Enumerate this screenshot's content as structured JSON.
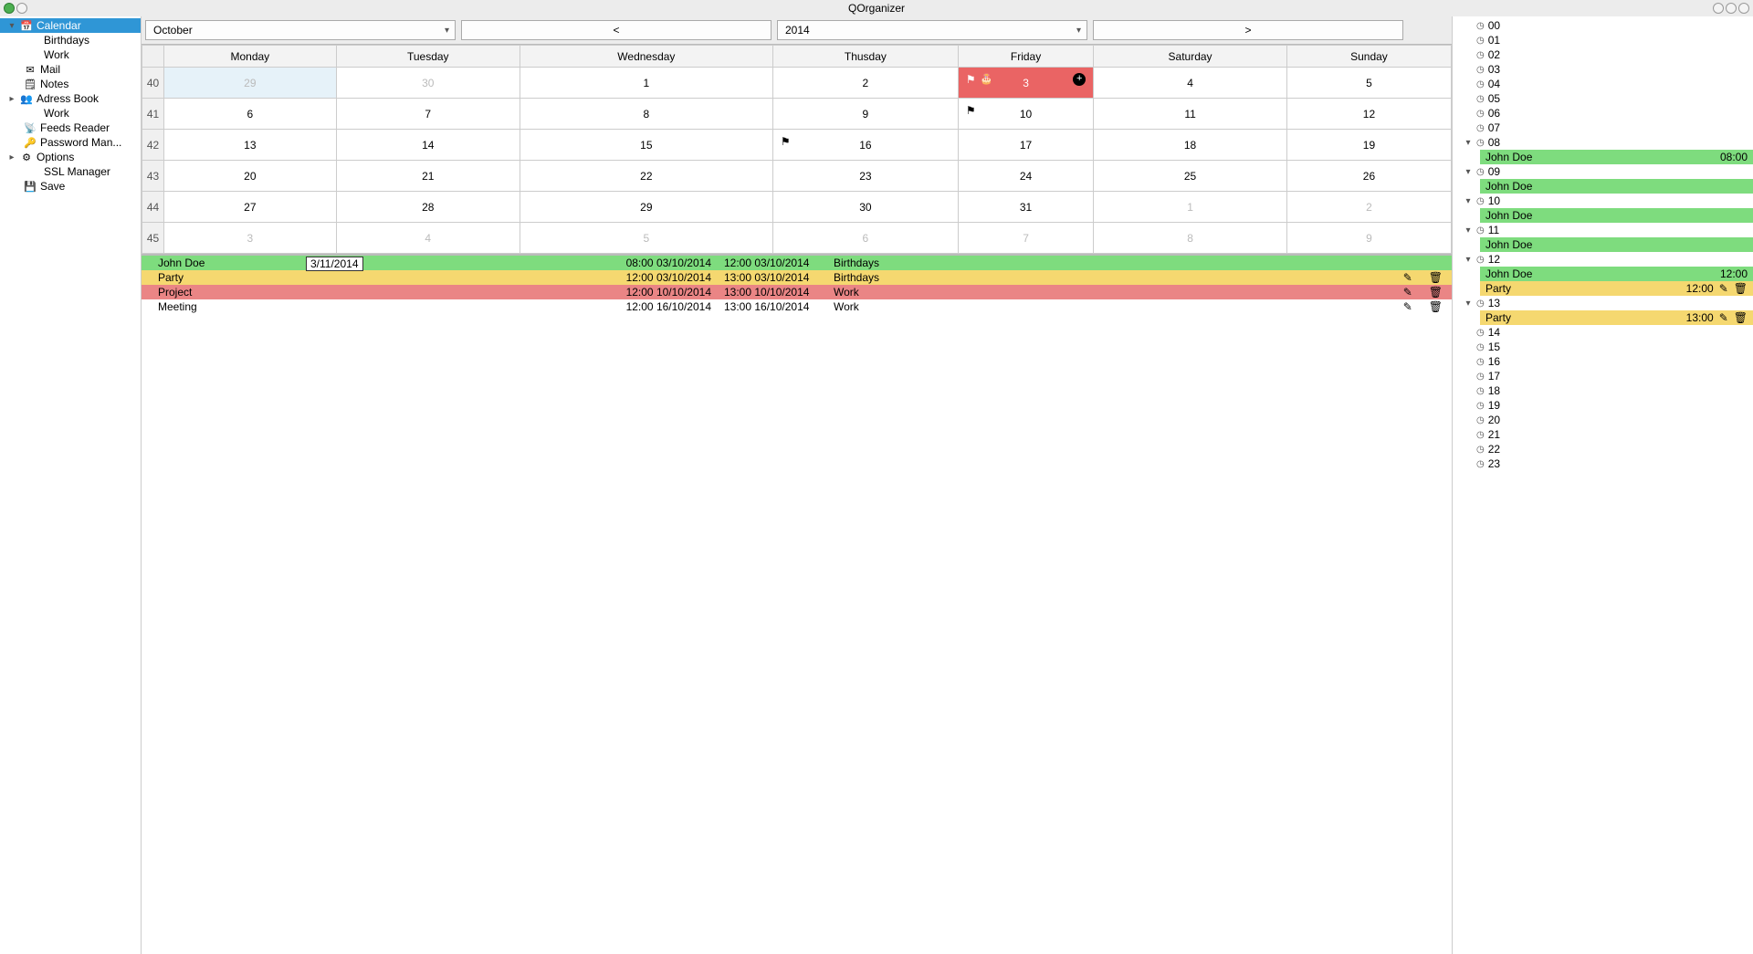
{
  "window": {
    "title": "QOrganizer"
  },
  "sidebar": {
    "items": [
      {
        "label": "Calendar",
        "icon": "📅",
        "selected": true,
        "expander": "▾",
        "indent": 0
      },
      {
        "label": "Birthdays",
        "icon": "",
        "indent": 2
      },
      {
        "label": "Work",
        "icon": "",
        "indent": 2
      },
      {
        "label": "Mail",
        "icon": "✉",
        "indent": 1
      },
      {
        "label": "Notes",
        "icon": "🗒",
        "indent": 1
      },
      {
        "label": "Adress Book",
        "icon": "👥",
        "expander": "▸",
        "indent": 0
      },
      {
        "label": "Work",
        "icon": "",
        "indent": 2
      },
      {
        "label": "Feeds Reader",
        "icon": "📡",
        "indent": 1
      },
      {
        "label": "Password Man...",
        "icon": "🔑",
        "indent": 1
      },
      {
        "label": "Options",
        "icon": "⚙",
        "expander": "▸",
        "indent": 0
      },
      {
        "label": "SSL Manager",
        "icon": "",
        "indent": 2
      },
      {
        "label": "Save",
        "icon": "💾",
        "indent": 1
      }
    ]
  },
  "toolbar": {
    "month": "October",
    "prev": "<",
    "year": "2014",
    "next": ">"
  },
  "calendar": {
    "days": [
      "Monday",
      "Tuesday",
      "Wednesday",
      "Thusday",
      "Friday",
      "Saturday",
      "Sunday"
    ],
    "weeks": [
      {
        "wk": "40",
        "cells": [
          {
            "d": "29",
            "other": true,
            "selmon": true
          },
          {
            "d": "30",
            "other": true
          },
          {
            "d": "1"
          },
          {
            "d": "2"
          },
          {
            "d": "3",
            "today": true,
            "flag": true,
            "cake": true,
            "add": true
          },
          {
            "d": "4"
          },
          {
            "d": "5"
          }
        ]
      },
      {
        "wk": "41",
        "cells": [
          {
            "d": "6"
          },
          {
            "d": "7"
          },
          {
            "d": "8"
          },
          {
            "d": "9"
          },
          {
            "d": "10",
            "flag": true
          },
          {
            "d": "11"
          },
          {
            "d": "12"
          }
        ]
      },
      {
        "wk": "42",
        "cells": [
          {
            "d": "13"
          },
          {
            "d": "14"
          },
          {
            "d": "15"
          },
          {
            "d": "16",
            "flag": true
          },
          {
            "d": "17"
          },
          {
            "d": "18"
          },
          {
            "d": "19"
          }
        ]
      },
      {
        "wk": "43",
        "cells": [
          {
            "d": "20"
          },
          {
            "d": "21"
          },
          {
            "d": "22"
          },
          {
            "d": "23"
          },
          {
            "d": "24"
          },
          {
            "d": "25"
          },
          {
            "d": "26"
          }
        ]
      },
      {
        "wk": "44",
        "cells": [
          {
            "d": "27"
          },
          {
            "d": "28"
          },
          {
            "d": "29"
          },
          {
            "d": "30"
          },
          {
            "d": "31"
          },
          {
            "d": "1",
            "other": true
          },
          {
            "d": "2",
            "other": true
          }
        ]
      },
      {
        "wk": "45",
        "cells": [
          {
            "d": "3",
            "other": true
          },
          {
            "d": "4",
            "other": true
          },
          {
            "d": "5",
            "other": true
          },
          {
            "d": "6",
            "other": true
          },
          {
            "d": "7",
            "other": true
          },
          {
            "d": "8",
            "other": true
          },
          {
            "d": "9",
            "other": true
          }
        ]
      }
    ]
  },
  "eventbox_date": "3/11/2014",
  "events": [
    {
      "title": "John Doe",
      "t1": "08:00 03/10/2014",
      "t2": "12:00 03/10/2014",
      "cat": "Birthdays",
      "color": "green",
      "tools": false
    },
    {
      "title": "Party",
      "t1": "12:00 03/10/2014",
      "t2": "13:00 03/10/2014",
      "cat": "Birthdays",
      "color": "yellow",
      "tools": true
    },
    {
      "title": "Project",
      "t1": "12:00 10/10/2014",
      "t2": "13:00 10/10/2014",
      "cat": "Work",
      "color": "red",
      "tools": true
    },
    {
      "title": "Meeting",
      "t1": "12:00 16/10/2014",
      "t2": "13:00 16/10/2014",
      "cat": "Work",
      "color": "",
      "tools": true
    }
  ],
  "daypanel": {
    "hours": [
      {
        "h": "00"
      },
      {
        "h": "01"
      },
      {
        "h": "02"
      },
      {
        "h": "03"
      },
      {
        "h": "04"
      },
      {
        "h": "05"
      },
      {
        "h": "06"
      },
      {
        "h": "07"
      },
      {
        "h": "08",
        "exp": "▾",
        "events": [
          {
            "title": "John Doe",
            "time": "08:00",
            "color": "green"
          }
        ]
      },
      {
        "h": "09",
        "exp": "▾",
        "events": [
          {
            "title": "John Doe",
            "color": "green"
          }
        ]
      },
      {
        "h": "10",
        "exp": "▾",
        "events": [
          {
            "title": "John Doe",
            "color": "green"
          }
        ]
      },
      {
        "h": "11",
        "exp": "▾",
        "events": [
          {
            "title": "John Doe",
            "color": "green"
          }
        ]
      },
      {
        "h": "12",
        "exp": "▾",
        "events": [
          {
            "title": "John Doe",
            "time": "12:00",
            "color": "green"
          },
          {
            "title": "Party",
            "time": "12:00",
            "color": "yellow",
            "tools": true
          }
        ]
      },
      {
        "h": "13",
        "exp": "▾",
        "events": [
          {
            "title": "Party",
            "time": "13:00",
            "color": "yellow",
            "tools": true
          }
        ]
      },
      {
        "h": "14"
      },
      {
        "h": "15"
      },
      {
        "h": "16"
      },
      {
        "h": "17"
      },
      {
        "h": "18"
      },
      {
        "h": "19"
      },
      {
        "h": "20"
      },
      {
        "h": "21"
      },
      {
        "h": "22"
      },
      {
        "h": "23"
      }
    ]
  },
  "icons": {
    "flag": "⚑",
    "cake": "🎂",
    "plus": "+",
    "pen": "✎",
    "trash": "🗑",
    "clock": "◷"
  }
}
